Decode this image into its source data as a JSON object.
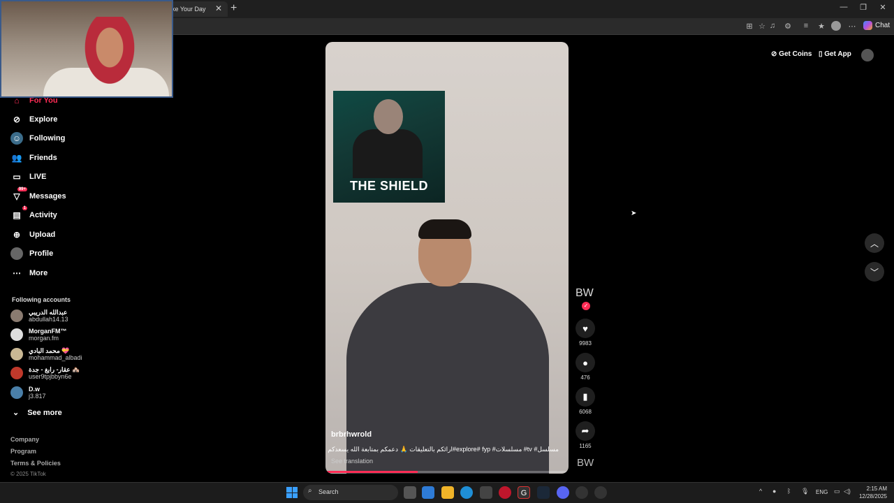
{
  "browser": {
    "tab_title": "ke Your Day",
    "tab_close": "✕",
    "new_tab": "+",
    "chat_label": "Chat",
    "window_controls": [
      "—",
      "❐",
      "✕"
    ]
  },
  "topbar": {
    "get_coins": "Get Coins",
    "get_app": "Get App"
  },
  "sidebar": {
    "nav": [
      {
        "label": "For You",
        "icon": "home-icon"
      },
      {
        "label": "Explore",
        "icon": "compass-icon"
      },
      {
        "label": "Following",
        "icon": "following-icon"
      },
      {
        "label": "Friends",
        "icon": "friends-icon"
      },
      {
        "label": "LIVE",
        "icon": "live-icon"
      },
      {
        "label": "Messages",
        "icon": "messages-icon",
        "badge": "99+"
      },
      {
        "label": "Activity",
        "icon": "activity-icon",
        "badge": "1"
      },
      {
        "label": "Upload",
        "icon": "upload-icon"
      },
      {
        "label": "Profile",
        "icon": "avatar"
      },
      {
        "label": "More",
        "icon": "more-icon"
      }
    ],
    "following_title": "Following accounts",
    "accounts": [
      {
        "name": "عبدالله الدريبي",
        "handle": "abdullah14.13"
      },
      {
        "name": "MorganFM™",
        "handle": "morgan.fm"
      },
      {
        "name": "محمد البادي 💝",
        "handle": "mohammad_albadi"
      },
      {
        "name": "عقار- رابغ - جدة 🏘️",
        "handle": "user9tpjbbyn6e"
      },
      {
        "name": "D.w",
        "handle": "j3.817"
      }
    ],
    "see_more": "See more",
    "footer": [
      "Company",
      "Program",
      "Terms & Policies"
    ],
    "copyright": "© 2025 TikTok"
  },
  "video": {
    "poster_title": "THE SHIELD",
    "author": "brbrhwrold",
    "caption": "مسلسل# tv# مسلسلات# explore# fyp#ارائكم بالتعليقات 🙏 دعمكم بمتابعة الله يسعدكم",
    "see_translation": "See translation",
    "progress": 0.38
  },
  "actions": {
    "creator_initials": "BW",
    "follow_icon": "✓",
    "likes": "9983",
    "comments": "476",
    "saves": "6068",
    "shares": "1165",
    "music_initials": "BW"
  },
  "taskbar": {
    "search_label": "Search",
    "lang": "ENG",
    "time": "2:15 AM",
    "date": "12/28/2025"
  }
}
